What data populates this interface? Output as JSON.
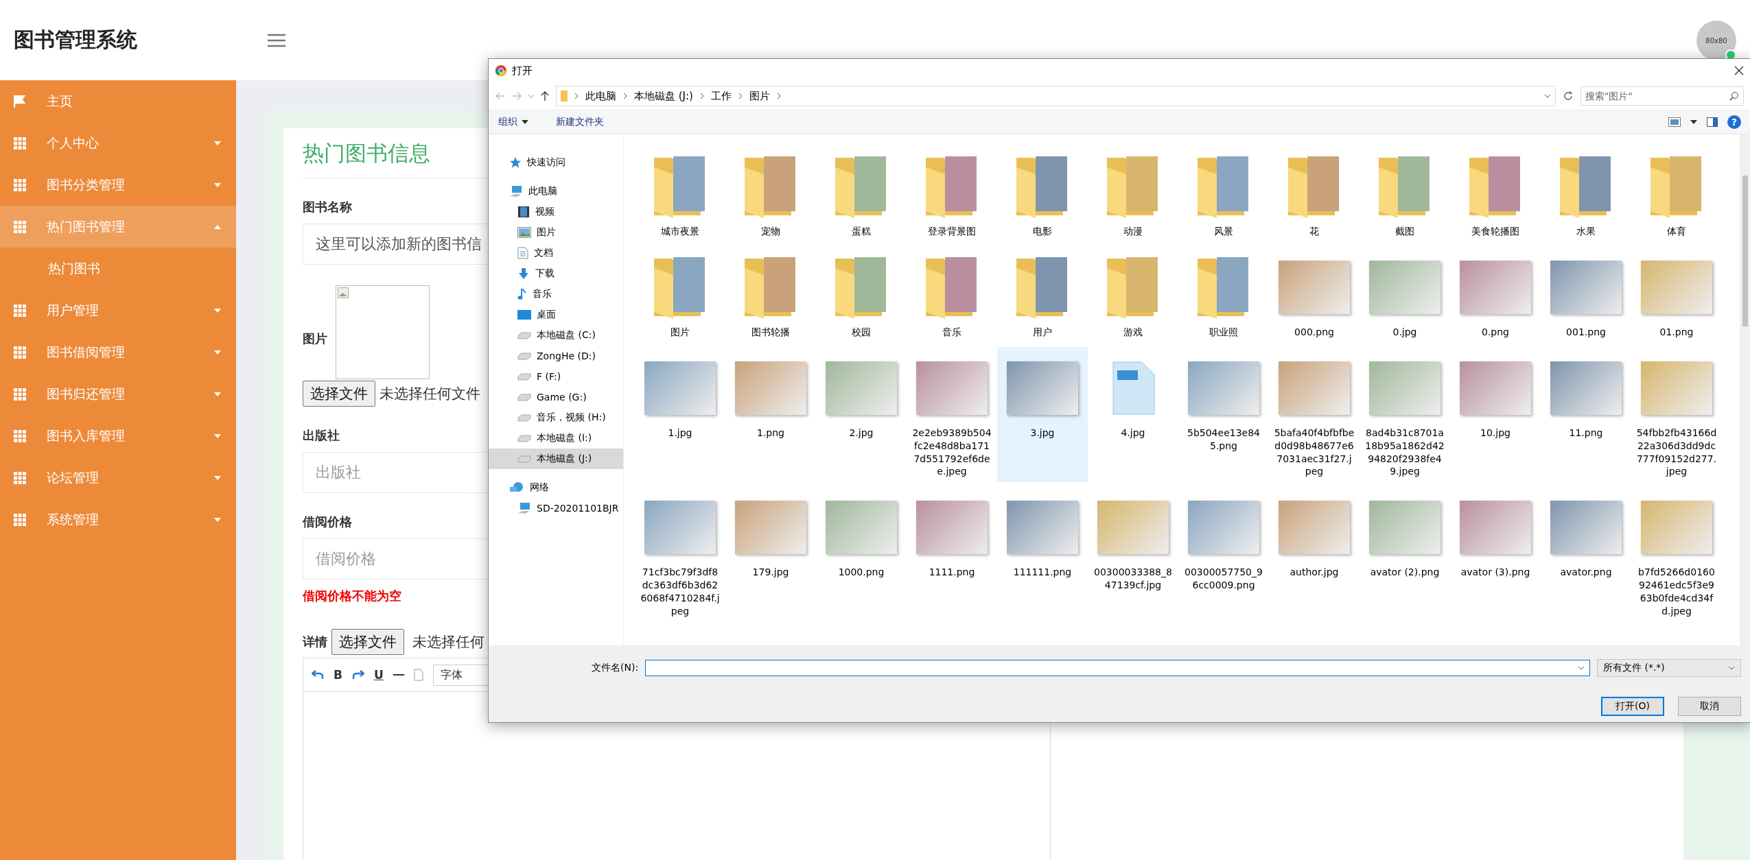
{
  "header": {
    "title": "图书管理系统",
    "avatar": "80x80",
    "online": true
  },
  "sidebar": {
    "items": [
      {
        "kind": "link",
        "label": "主页",
        "expanded": false
      },
      {
        "kind": "group",
        "label": "个人中心",
        "expanded": false
      },
      {
        "kind": "group",
        "label": "图书分类管理",
        "expanded": false
      },
      {
        "kind": "group",
        "label": "热门图书管理",
        "expanded": true,
        "children": [
          {
            "label": "热门图书"
          }
        ]
      },
      {
        "kind": "group",
        "label": "用户管理",
        "expanded": false
      },
      {
        "kind": "group",
        "label": "图书借阅管理",
        "expanded": false
      },
      {
        "kind": "group",
        "label": "图书归还管理",
        "expanded": false
      },
      {
        "kind": "group",
        "label": "图书入库管理",
        "expanded": false
      },
      {
        "kind": "group",
        "label": "论坛管理",
        "expanded": false
      },
      {
        "kind": "group",
        "label": "系统管理",
        "expanded": false
      }
    ]
  },
  "form": {
    "title": "热门图书信息",
    "name_field": {
      "label": "图书名称",
      "value": "这里可以添加新的图书信"
    },
    "image_field": {
      "label": "图片",
      "button": "选择文件",
      "status": "未选择任何文件"
    },
    "publisher_field": {
      "label": "出版社",
      "placeholder": "出版社"
    },
    "price_field": {
      "label": "借阅价格",
      "placeholder": "借阅价格",
      "error": "借阅价格不能为空"
    },
    "details_field": {
      "label": "详情",
      "button": "选择文件",
      "status": "未选择任何"
    },
    "editor_toolbar": [
      {
        "kind": "undo"
      },
      {
        "kind": "text",
        "label": "B"
      },
      {
        "kind": "redo"
      },
      {
        "kind": "underline",
        "label": "U"
      },
      {
        "kind": "rule"
      },
      {
        "kind": "page"
      },
      {
        "kind": "select",
        "label": "字体"
      }
    ]
  },
  "dialog": {
    "title": "打开",
    "breadcrumb": [
      "此电脑",
      "本地磁盘 (J:)",
      "工作",
      "图片"
    ],
    "search": {
      "placeholder": "搜索\"图片\""
    },
    "toolbar": {
      "organize": "组织",
      "new_folder": "新建文件夹",
      "help": "?"
    },
    "nav": [
      {
        "kind": "star",
        "label": "快速访问",
        "selected": false
      },
      {
        "kind": "pc",
        "label": "此电脑",
        "selected": false,
        "children": [
          {
            "kind": "video",
            "label": "视频",
            "selected": false
          },
          {
            "kind": "picture",
            "label": "图片",
            "selected": false
          },
          {
            "kind": "doc",
            "label": "文档",
            "selected": false
          },
          {
            "kind": "download",
            "label": "下载",
            "selected": false
          },
          {
            "kind": "music",
            "label": "音乐",
            "selected": false
          },
          {
            "kind": "desktop",
            "label": "桌面",
            "selected": false
          },
          {
            "kind": "drive",
            "label": "本地磁盘 (C:)",
            "selected": false
          },
          {
            "kind": "drive",
            "label": "ZongHe (D:)",
            "selected": false
          },
          {
            "kind": "drive",
            "label": "F (F:)",
            "selected": false
          },
          {
            "kind": "drive",
            "label": "Game (G:)",
            "selected": false
          },
          {
            "kind": "drive",
            "label": "音乐，视频 (H:)",
            "selected": false
          },
          {
            "kind": "drive",
            "label": "本地磁盘 (I:)",
            "selected": false
          },
          {
            "kind": "drive",
            "label": "本地磁盘 (J:)",
            "selected": true
          }
        ]
      },
      {
        "kind": "network",
        "label": "网络",
        "selected": false,
        "children": [
          {
            "kind": "pc",
            "label": "SD-20201101BJR",
            "selected": false
          }
        ]
      }
    ],
    "files": [
      {
        "kind": "folder",
        "name": "城市夜景",
        "selected": false
      },
      {
        "kind": "folder",
        "name": "宠物",
        "selected": false
      },
      {
        "kind": "folder",
        "name": "蛋糕",
        "selected": false
      },
      {
        "kind": "folder",
        "name": "登录背景图",
        "selected": false
      },
      {
        "kind": "folder",
        "name": "电影",
        "selected": false
      },
      {
        "kind": "folder",
        "name": "动漫",
        "selected": false
      },
      {
        "kind": "folder",
        "name": "风景",
        "selected": false
      },
      {
        "kind": "folder",
        "name": "花",
        "selected": false
      },
      {
        "kind": "folder",
        "name": "截图",
        "selected": false
      },
      {
        "kind": "folder",
        "name": "美食轮播图",
        "selected": false
      },
      {
        "kind": "folder",
        "name": "水果",
        "selected": false
      },
      {
        "kind": "folder",
        "name": "体育",
        "selected": false
      },
      {
        "kind": "folder",
        "name": "图片",
        "selected": false
      },
      {
        "kind": "folder",
        "name": "图书轮播",
        "selected": false
      },
      {
        "kind": "folder",
        "name": "校园",
        "selected": false
      },
      {
        "kind": "folder",
        "name": "音乐",
        "selected": false
      },
      {
        "kind": "folder",
        "name": "用户",
        "selected": false
      },
      {
        "kind": "folder",
        "name": "游戏",
        "selected": false
      },
      {
        "kind": "folder",
        "name": "职业照",
        "selected": false
      },
      {
        "kind": "image",
        "name": "000.png",
        "selected": false
      },
      {
        "kind": "image",
        "name": "0.jpg",
        "selected": false
      },
      {
        "kind": "image",
        "name": "0.png",
        "selected": false
      },
      {
        "kind": "image",
        "name": "001.png",
        "selected": false
      },
      {
        "kind": "image",
        "name": "01.png",
        "selected": false
      },
      {
        "kind": "image",
        "name": "1.jpg",
        "selected": false
      },
      {
        "kind": "image",
        "name": "1.png",
        "selected": false
      },
      {
        "kind": "image",
        "name": "2.jpg",
        "selected": false
      },
      {
        "kind": "image",
        "name": "2e2eb9389b504fc2e48d8ba1717d551792ef6dee.jpeg",
        "selected": false
      },
      {
        "kind": "image",
        "name": "3.jpg",
        "selected": true
      },
      {
        "kind": "generic",
        "name": "4.jpg",
        "selected": false
      },
      {
        "kind": "image",
        "name": "5b504ee13e845.png",
        "selected": false
      },
      {
        "kind": "image",
        "name": "5bafa40f4bfbfbed0d98b48677e67031aec31f27.jpeg",
        "selected": false
      },
      {
        "kind": "image",
        "name": "8ad4b31c8701a18b95a1862d4294820f2938fe49.jpeg",
        "selected": false
      },
      {
        "kind": "image",
        "name": "10.jpg",
        "selected": false
      },
      {
        "kind": "image",
        "name": "11.png",
        "selected": false
      },
      {
        "kind": "image",
        "name": "54fbb2fb43166d22a306d3dd9dc777f09152d277.jpeg",
        "selected": false
      },
      {
        "kind": "image",
        "name": "71cf3bc79f3df8dc363df6b3d626068f4710284f.jpeg",
        "selected": false
      },
      {
        "kind": "image",
        "name": "179.jpg",
        "selected": false
      },
      {
        "kind": "image",
        "name": "1000.png",
        "selected": false
      },
      {
        "kind": "image",
        "name": "1111.png",
        "selected": false
      },
      {
        "kind": "image",
        "name": "111111.png",
        "selected": false
      },
      {
        "kind": "image",
        "name": "00300033388_847139cf.jpg",
        "selected": false
      },
      {
        "kind": "image",
        "name": "00300057750_96cc0009.png",
        "selected": false
      },
      {
        "kind": "image",
        "name": "author.jpg",
        "selected": false
      },
      {
        "kind": "image",
        "name": "avator (2).png",
        "selected": false
      },
      {
        "kind": "image",
        "name": "avator (3).png",
        "selected": false
      },
      {
        "kind": "image",
        "name": "avator.png",
        "selected": false
      },
      {
        "kind": "image",
        "name": "b7fd5266d016092461edc5f3e963b0fde4cd34fd.jpeg",
        "selected": false
      }
    ],
    "filename": {
      "label": "文件名(N):"
    },
    "filter": "所有文件 (*.*)",
    "buttons": [
      {
        "label": "打开(O)",
        "primary": true
      },
      {
        "label": "取消",
        "primary": false
      }
    ]
  }
}
